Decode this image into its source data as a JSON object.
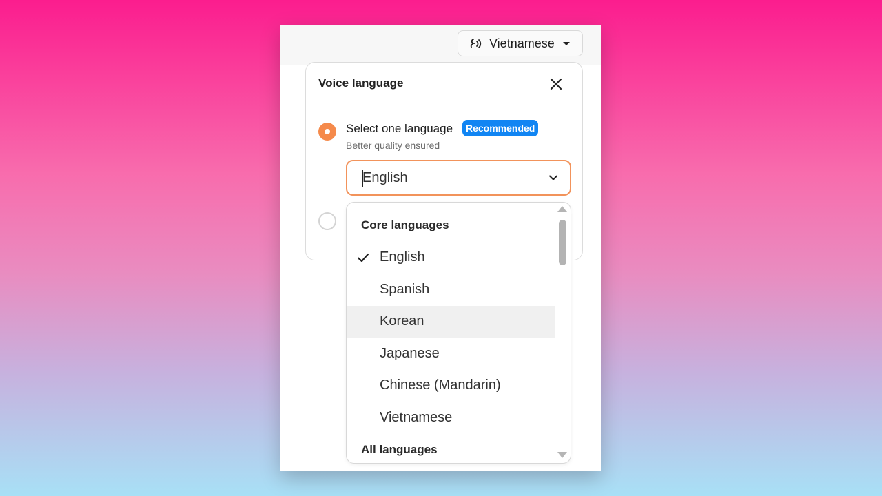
{
  "header": {
    "language_button_label": "Vietnamese"
  },
  "panel": {
    "title": "Voice language",
    "option_one": {
      "label": "Select one language",
      "badge": "Recommended",
      "sublabel": "Better quality ensured",
      "selected_value": "English"
    }
  },
  "dropdown": {
    "groups": [
      {
        "header": "Core languages",
        "items": [
          {
            "label": "English",
            "checked": true
          },
          {
            "label": "Spanish"
          },
          {
            "label": "Korean",
            "hovered": true
          },
          {
            "label": "Japanese"
          },
          {
            "label": "Chinese (Mandarin)"
          },
          {
            "label": "Vietnamese"
          }
        ]
      },
      {
        "header": "All languages"
      }
    ]
  },
  "colors": {
    "accent_orange": "#f58a4b",
    "badge_blue": "#1185f3"
  },
  "icons": {
    "language_button": "voice-language-icon",
    "close": "close-icon",
    "field": "chevron-down-icon",
    "selected_item": "check-icon"
  }
}
